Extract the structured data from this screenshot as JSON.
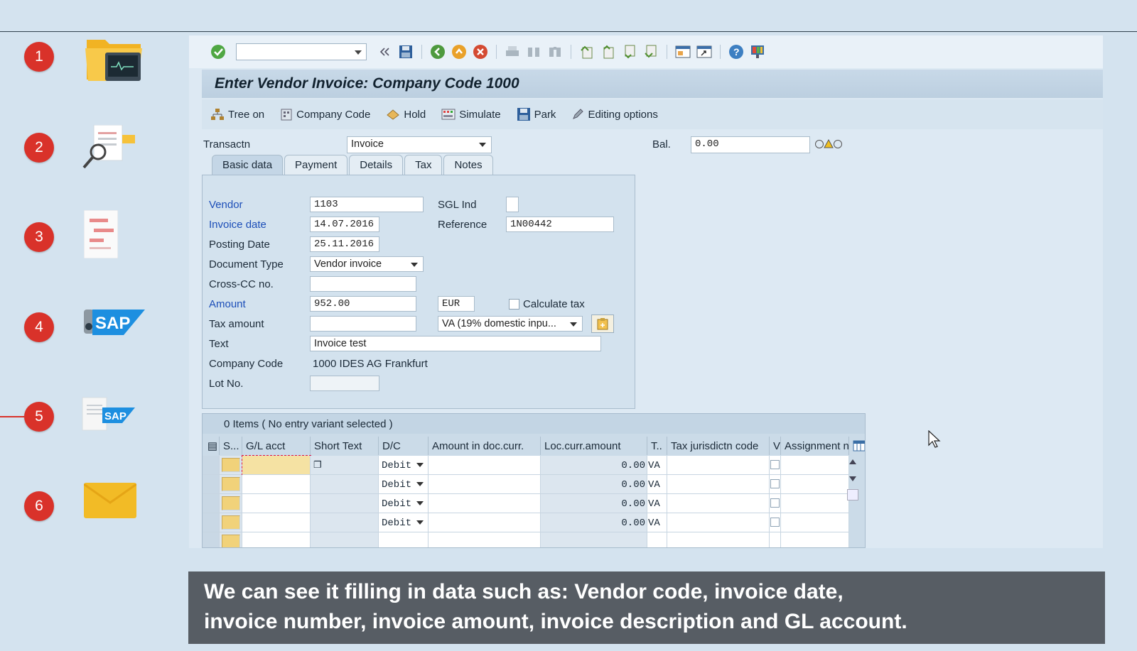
{
  "steps": [
    "1",
    "2",
    "3",
    "4",
    "5",
    "6"
  ],
  "colors": {
    "step_red": "#d9322a",
    "caption_bg": "#575d64",
    "sap_blue": "#1c4eb8"
  },
  "rail_icons": [
    "folder-screen-icon",
    "document-search-icon",
    "document-list-icon",
    "sap-logo-icon",
    "document-sap-icon",
    "envelope-icon"
  ],
  "sap_logo_text": "SAP",
  "toolbar": {
    "command_field": "",
    "icons": [
      "check-icon",
      "back-double-icon",
      "save-icon",
      "back-icon",
      "exit-icon",
      "cancel-icon",
      "print-icon",
      "find-icon",
      "find-next-icon",
      "first-page-icon",
      "prev-page-icon",
      "next-page-icon",
      "last-page-icon",
      "new-session-icon",
      "shortcut-icon",
      "help-icon",
      "layout-icon"
    ]
  },
  "title": "Enter Vendor Invoice: Company Code 1000",
  "appbar": {
    "tree_on": "Tree on",
    "company_code": "Company Code",
    "hold": "Hold",
    "simulate": "Simulate",
    "park": "Park",
    "editing_options": "Editing options"
  },
  "header": {
    "transactn_label": "Transactn",
    "transactn_value": "Invoice",
    "bal_label": "Bal.",
    "bal_value": "0.00"
  },
  "tabs": [
    "Basic data",
    "Payment",
    "Details",
    "Tax",
    "Notes"
  ],
  "form": {
    "vendor_label": "Vendor",
    "vendor_value": "1103",
    "sgl_label": "SGL Ind",
    "invoice_date_label": "Invoice date",
    "invoice_date_value": "14.07.2016",
    "reference_label": "Reference",
    "reference_value": "1N00442",
    "posting_date_label": "Posting Date",
    "posting_date_value": "25.11.2016",
    "doc_type_label": "Document Type",
    "doc_type_value": "Vendor invoice",
    "cross_cc_label": "Cross-CC no.",
    "amount_label": "Amount",
    "amount_value": "952.00",
    "currency_value": "EUR",
    "calc_tax_label": "Calculate tax",
    "tax_amount_label": "Tax amount",
    "tax_code_value": "VA (19% domestic inpu...",
    "text_label": "Text",
    "text_value": "Invoice test",
    "company_code_label": "Company Code",
    "company_code_value": "1000 IDES AG Frankfurt",
    "lot_no_label": "Lot No."
  },
  "items": {
    "title": "0 Items ( No entry variant selected )",
    "columns": [
      "S...",
      "G/L acct",
      "Short Text",
      "D/C",
      "Amount in doc.curr.",
      "Loc.curr.amount",
      "T..",
      "Tax jurisdictn code",
      "V",
      "Assignment n"
    ],
    "rows": [
      {
        "dc": "Debit",
        "loc": "0.00",
        "tax": "VA"
      },
      {
        "dc": "Debit",
        "loc": "0.00",
        "tax": "VA"
      },
      {
        "dc": "Debit",
        "loc": "0.00",
        "tax": "VA"
      },
      {
        "dc": "Debit",
        "loc": "0.00",
        "tax": "VA"
      }
    ]
  },
  "caption": {
    "line1": "We can see it filling in data such as: Vendor code, invoice date,",
    "line2": "invoice number, invoice amount, invoice description and GL account."
  }
}
